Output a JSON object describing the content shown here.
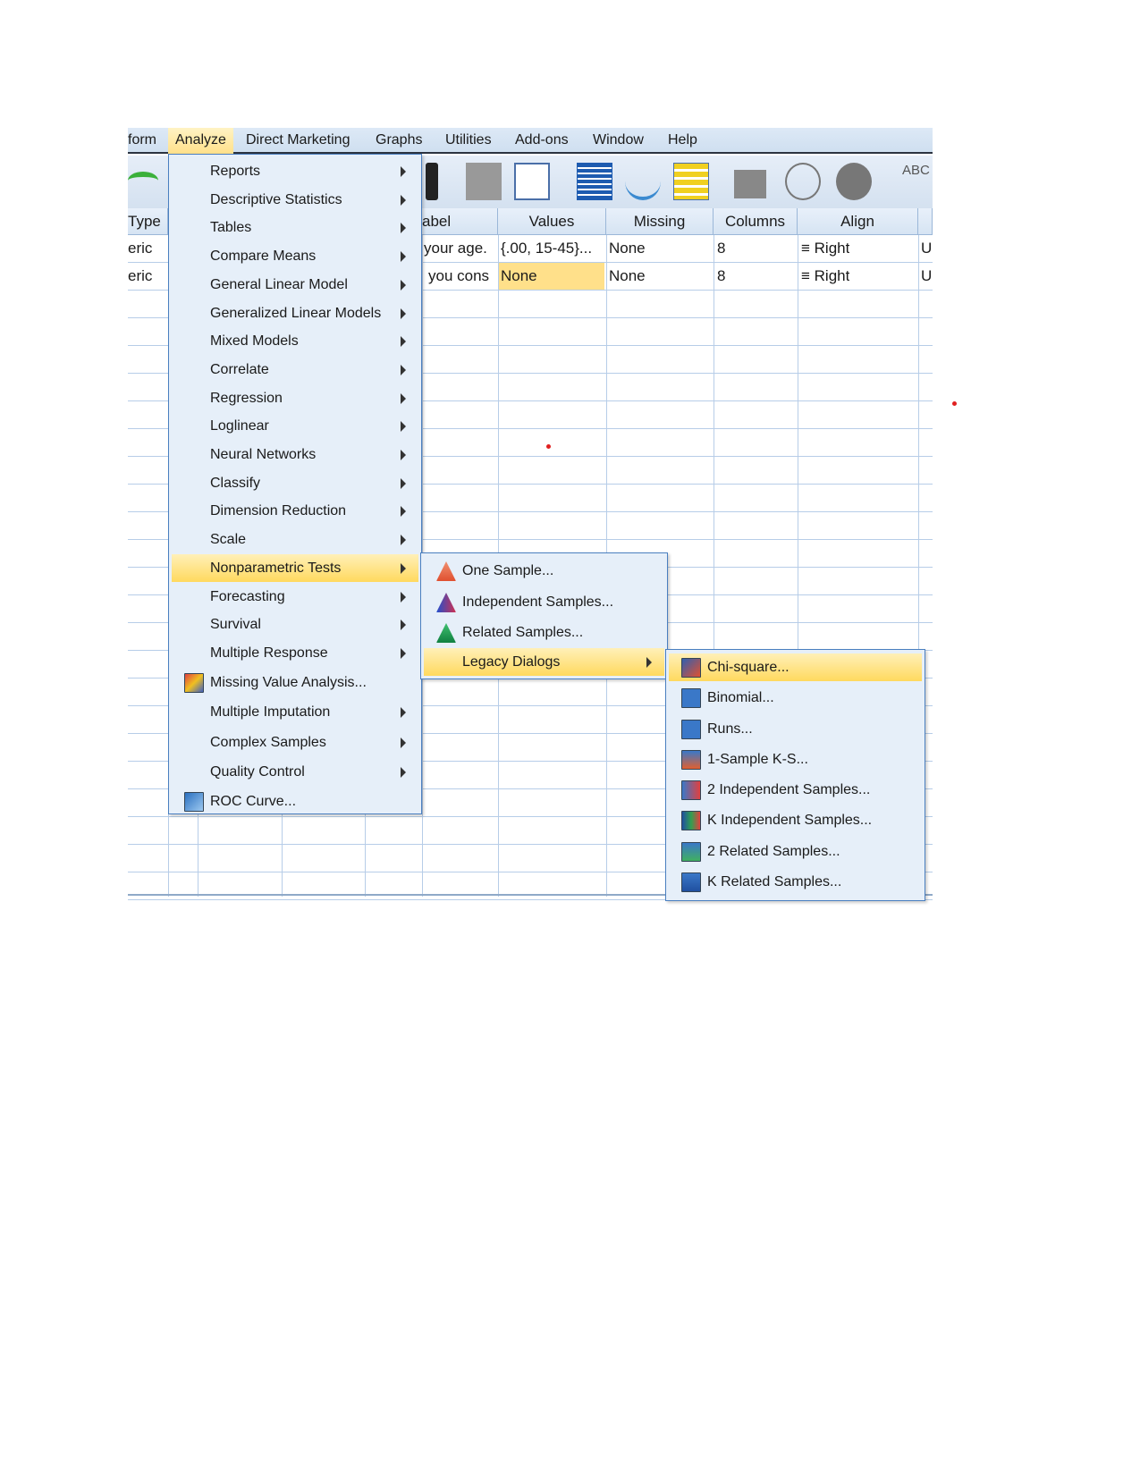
{
  "menubar": [
    "form",
    "Analyze",
    "Direct Marketing",
    "Graphs",
    "Utilities",
    "Add-ons",
    "Window",
    "Help"
  ],
  "columns": {
    "type": "Type",
    "label": "abel",
    "values": "Values",
    "missing": "Missing",
    "columns": "Columns",
    "align": "Align"
  },
  "rows": [
    {
      "type": "eric",
      "label": "your age.",
      "values": "{.00, 15-45}...",
      "missing": "None",
      "columns": "8",
      "align": "Right",
      "extra": "U"
    },
    {
      "type": "eric",
      "label": "you cons",
      "values": "None",
      "missing": "None",
      "columns": "8",
      "align": "Right",
      "extra": "U"
    }
  ],
  "analyze_menu": [
    "Reports",
    "Descriptive Statistics",
    "Tables",
    "Compare Means",
    "General Linear Model",
    "Generalized Linear Models",
    "Mixed Models",
    "Correlate",
    "Regression",
    "Loglinear",
    "Neural Networks",
    "Classify",
    "Dimension Reduction",
    "Scale",
    "Nonparametric Tests",
    "Forecasting",
    "Survival",
    "Multiple Response",
    "Missing Value Analysis...",
    "Multiple Imputation",
    "Complex Samples",
    "Quality Control",
    "ROC Curve..."
  ],
  "nonparametric_menu": [
    "One Sample...",
    "Independent Samples...",
    "Related Samples...",
    "Legacy Dialogs"
  ],
  "legacy_menu": [
    "Chi-square...",
    "Binomial...",
    "Runs...",
    "1-Sample K-S...",
    "2 Independent Samples...",
    "K Independent Samples...",
    "2 Related Samples...",
    "K Related Samples..."
  ],
  "colors": {
    "highlight": "#ffd95e",
    "menu_bg": "#e6eff9",
    "menu_border": "#4a7fc0",
    "selected_cell": "#ffe08a"
  }
}
